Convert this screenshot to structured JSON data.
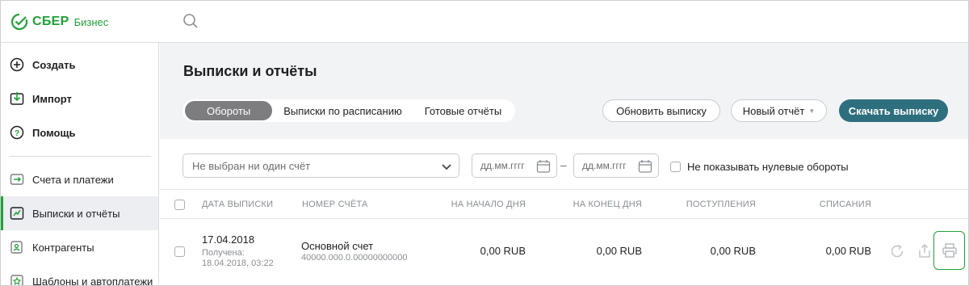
{
  "brand": {
    "name": "СБЕР",
    "sub": "Бизнес",
    "color": "#21a038"
  },
  "sidebar": {
    "items": [
      {
        "label": "Создать",
        "icon": "plus-circle-icon"
      },
      {
        "label": "Импорт",
        "icon": "import-icon"
      },
      {
        "label": "Помощь",
        "icon": "help-icon"
      },
      {
        "label": "Счета и платежи",
        "icon": "accounts-icon"
      },
      {
        "label": "Выписки и отчёты",
        "icon": "statements-icon",
        "active": true
      },
      {
        "label": "Контрагенты",
        "icon": "contacts-icon"
      },
      {
        "label": "Шаблоны и автоплатежи",
        "icon": "templates-icon"
      }
    ]
  },
  "main": {
    "title": "Выписки и отчёты",
    "tabs": [
      {
        "label": "Обороты",
        "active": true
      },
      {
        "label": "Выписки по расписанию"
      },
      {
        "label": "Готовые отчёты"
      }
    ],
    "actions": {
      "refresh": "Обновить выписку",
      "new_report": "Новый отчёт",
      "download": "Скачать выписку"
    },
    "filters": {
      "account_placeholder": "Не выбран ни один счёт",
      "date_from_placeholder": "дд.мм.гггг",
      "date_to_placeholder": "дд.мм.гггг",
      "hide_zero_label": "Не показывать нулевые обороты"
    },
    "table": {
      "columns": [
        "ДАТА ВЫПИСКИ",
        "НОМЕР СЧЁТА",
        "НА НАЧАЛО ДНЯ",
        "НА КОНЕЦ ДНЯ",
        "ПОСТУПЛЕНИЯ",
        "СПИСАНИЯ"
      ],
      "rows": [
        {
          "date": "17.04.2018",
          "received_label": "Получена:",
          "received": "18.04.2018, 03:22",
          "account_name": "Основной счет",
          "account_number": "40000.000.0.00000000000",
          "opening": "0,00 RUB",
          "closing": "0,00 RUB",
          "incoming": "0,00 RUB",
          "outgoing": "0,00 RUB"
        }
      ]
    }
  },
  "colors": {
    "accent": "#21a038",
    "primary_button": "#2e6f7e",
    "active_tab": "#7d7d80"
  }
}
